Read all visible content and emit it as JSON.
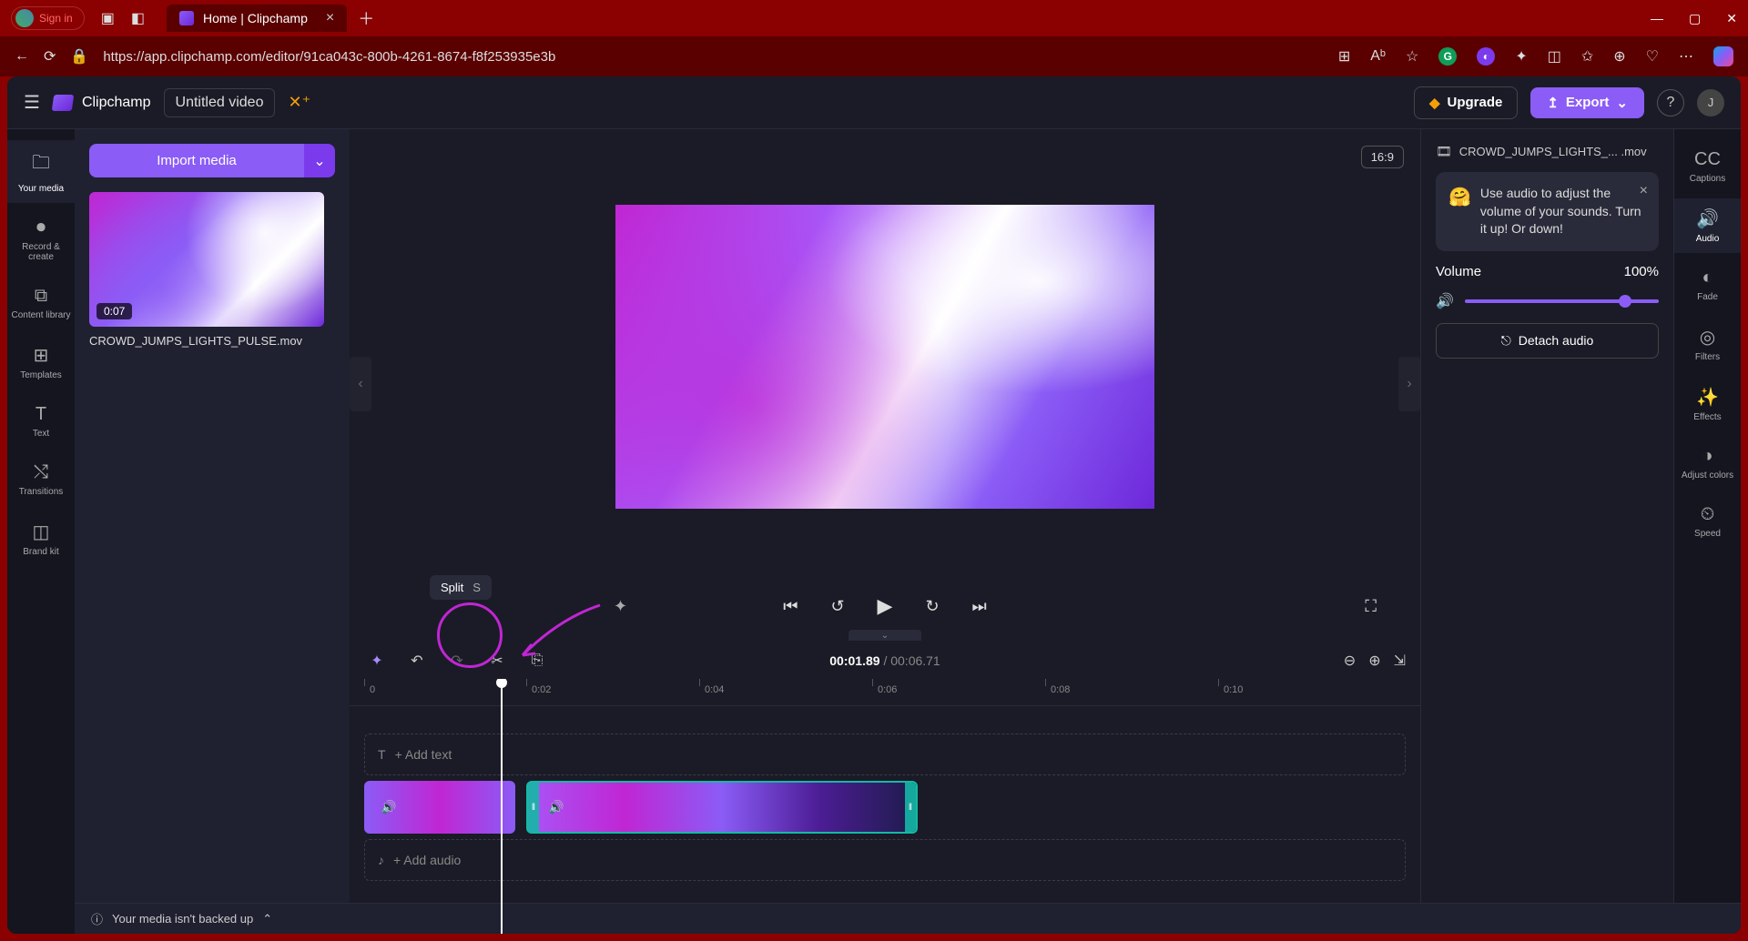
{
  "browser": {
    "signin": "Sign in",
    "tab_title": "Home | Clipchamp",
    "url": "https://app.clipchamp.com/editor/91ca043c-800b-4261-8674-f8f253935e3b"
  },
  "header": {
    "brand": "Clipchamp",
    "project": "Untitled video",
    "upgrade": "Upgrade",
    "export": "Export",
    "user_initial": "J"
  },
  "left_rail": [
    {
      "label": "Your media"
    },
    {
      "label": "Record & create"
    },
    {
      "label": "Content library"
    },
    {
      "label": "Templates"
    },
    {
      "label": "Text"
    },
    {
      "label": "Transitions"
    },
    {
      "label": "Brand kit"
    }
  ],
  "media_panel": {
    "import": "Import media",
    "item_duration": "0:07",
    "item_name": "CROWD_JUMPS_LIGHTS_PULSE.mov"
  },
  "stage": {
    "aspect": "16:9"
  },
  "tooltip": {
    "label": "Split",
    "key": "S"
  },
  "timeline": {
    "current": "00:01.89",
    "total": "00:06.71",
    "ticks": [
      "0",
      "0:02",
      "0:04",
      "0:06",
      "0:08",
      "0:10"
    ],
    "add_text": "+ Add text",
    "add_audio": "+ Add audio"
  },
  "backup": "Your media isn't backed up",
  "right_panel": {
    "clip_name": "CROWD_JUMPS_LIGHTS_... .mov",
    "tip": "Use audio to adjust the volume of your sounds. Turn it up! Or down!",
    "volume_label": "Volume",
    "volume_value": "100%",
    "detach": "Detach audio"
  },
  "right_rail": [
    {
      "label": "Captions"
    },
    {
      "label": "Audio"
    },
    {
      "label": "Fade"
    },
    {
      "label": "Filters"
    },
    {
      "label": "Effects"
    },
    {
      "label": "Adjust colors"
    },
    {
      "label": "Speed"
    }
  ]
}
